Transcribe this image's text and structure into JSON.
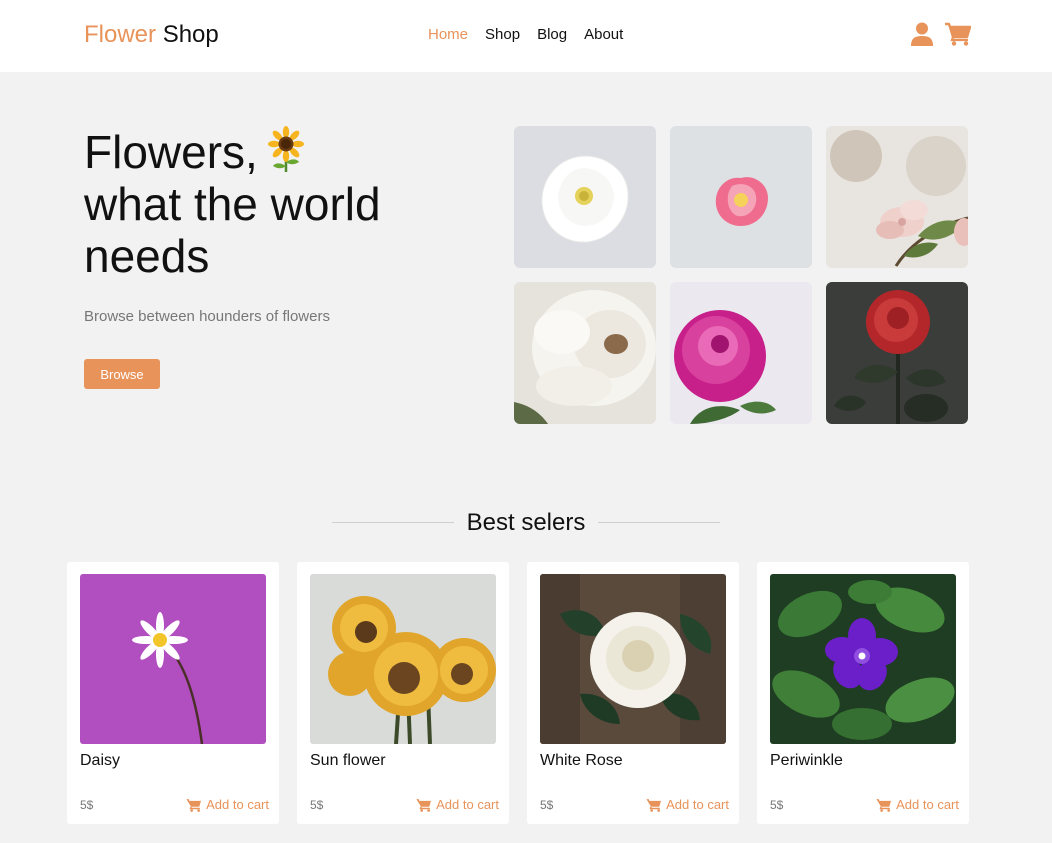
{
  "header": {
    "logo": {
      "part1": "Flower",
      "part2": "Shop"
    },
    "nav": [
      {
        "label": "Home",
        "active": true
      },
      {
        "label": "Shop",
        "active": false
      },
      {
        "label": "Blog",
        "active": false
      },
      {
        "label": "About",
        "active": false
      }
    ],
    "icons": [
      "user-icon",
      "cart-icon"
    ]
  },
  "hero": {
    "title_lines": [
      "Flowers,",
      "what the world",
      "needs"
    ],
    "title_emoji": "sunflower",
    "subtitle": "Browse between hounders of flowers",
    "button_label": "Browse",
    "gallery": [
      "white-rose-photo",
      "pink-flower-photo",
      "blossom-branch-photo",
      "white-peony-photo",
      "magenta-peony-photo",
      "red-rose-photo"
    ]
  },
  "best_sellers": {
    "title": "Best selers",
    "products": [
      {
        "name": "Daisy",
        "price": "5$",
        "action": "Add to cart"
      },
      {
        "name": "Sun flower",
        "price": "5$",
        "action": "Add to cart"
      },
      {
        "name": "White Rose",
        "price": "5$",
        "action": "Add to cart"
      },
      {
        "name": "Periwinkle",
        "price": "5$",
        "action": "Add to cart"
      }
    ]
  },
  "colors": {
    "accent": "#e8935a",
    "background": "#f2f2f2",
    "header": "#ffffff",
    "text": "#111111",
    "muted": "#777777"
  }
}
